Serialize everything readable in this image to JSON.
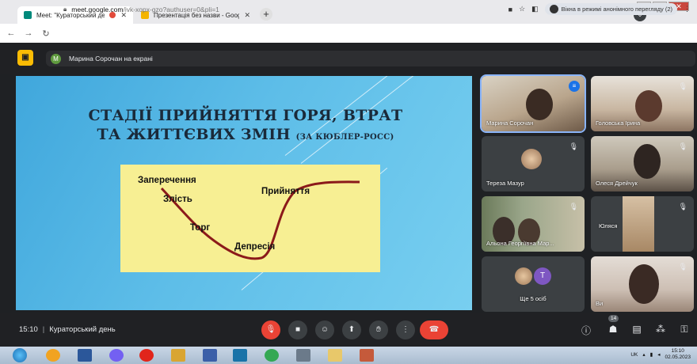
{
  "browser": {
    "tabs": [
      {
        "title": "Meet: \"Кураторський день\"",
        "active": true
      },
      {
        "title": "Презентація без назви - Google",
        "active": false
      }
    ],
    "url_host": "meet.google.com",
    "url_path": "/ivk-xopx-gzo?authuser=0&pli=1",
    "incognito_label": "Вікна в режимі анонімного перегляду (2)"
  },
  "meet": {
    "presenter_initial": "M",
    "presenter_text": "Марина Сорочан на екрані",
    "slide": {
      "title_line1": "СТАДІЇ ПРИЙНЯТТЯ ГОРЯ, ВТРАТ",
      "title_line2": "ТА ЖИТТЄВИХ ЗМІН",
      "title_sub": "(ЗА КЮБЛЕР-РОСС)",
      "stages": [
        "Заперечення",
        "Злість",
        "Торг",
        "Депресія",
        "Прийняття"
      ]
    },
    "participants": [
      {
        "name": "Марина Сорочан"
      },
      {
        "name": "Головська Ірина"
      },
      {
        "name": "Тереза Мазур"
      },
      {
        "name": "Олеся Дрейчук"
      },
      {
        "name": "Альона Георгіївна Мар..."
      },
      {
        "name": "Юляся"
      },
      {
        "name": "Ще 5 осіб",
        "initial": "T"
      },
      {
        "name": "Ви"
      }
    ],
    "time": "15:10",
    "meeting_name": "Кураторський день",
    "people_count": "14"
  },
  "taskbar": {
    "lang": "UK",
    "time": "15:10",
    "date": "02.05.2023"
  },
  "colors": {
    "accent_blue": "#1a73e8",
    "end_call_red": "#ea4335",
    "slide_blue": "#4fb3e4",
    "diagram_yellow": "#f7ef93",
    "curve_brown": "#8b1a1a"
  }
}
